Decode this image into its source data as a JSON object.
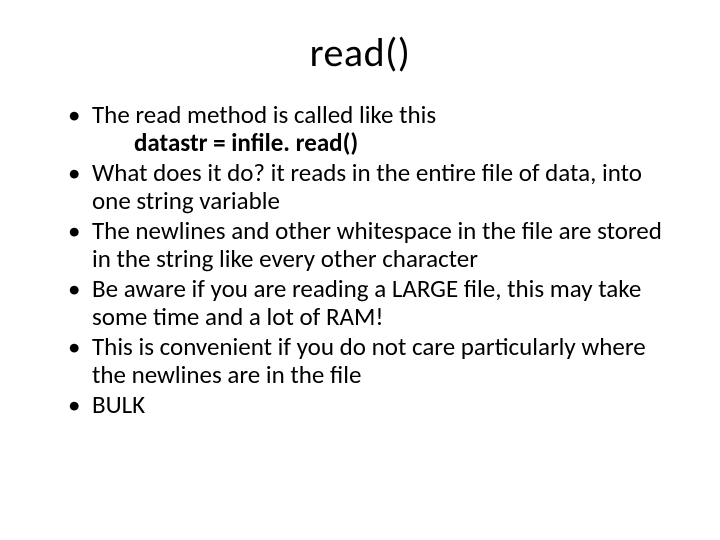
{
  "title": "read()",
  "bullets": [
    {
      "text": "The read method is called like this",
      "sub": "datastr =  infile. read()"
    },
    {
      "text": "What does it do?  it reads in the entire file of data, into one string variable"
    },
    {
      "text": "The newlines and other whitespace in the file are stored in the string like every other character"
    },
    {
      "text": "Be aware if you are reading a LARGE file, this may take some time and a lot of RAM!"
    },
    {
      "text": "This is convenient if you do not care particularly where the newlines are in the file"
    },
    {
      "text": "BULK"
    }
  ]
}
